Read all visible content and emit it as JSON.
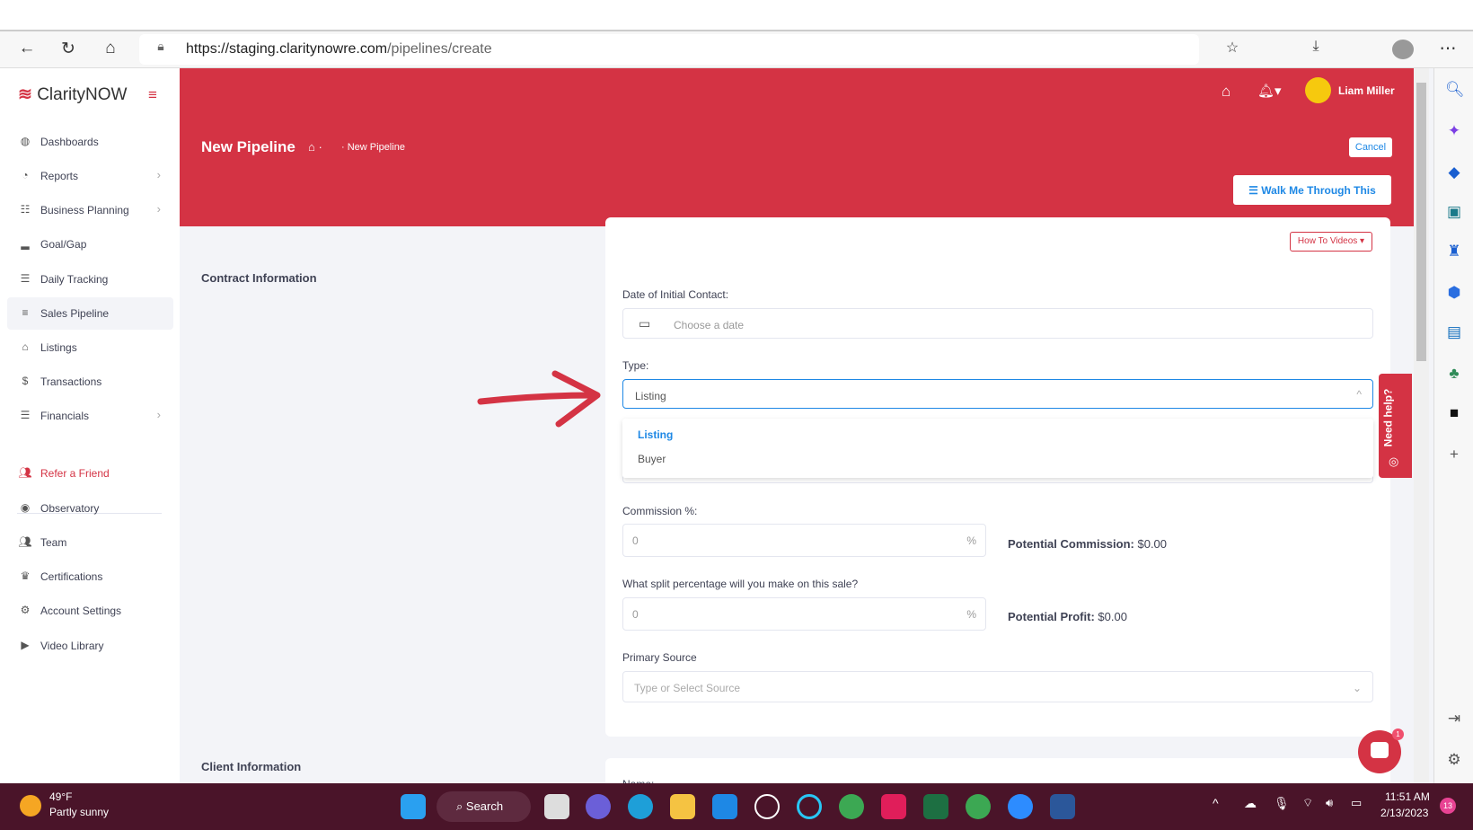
{
  "browser": {
    "url_host": "https://staging.claritynowre.com",
    "url_path": "/pipelines/create"
  },
  "app": {
    "name": "ClarityNOW"
  },
  "sidebar": {
    "items": [
      {
        "label": "Dashboards",
        "icon": "dashboard-icon",
        "chevron": false
      },
      {
        "label": "Reports",
        "icon": "pie-chart-icon",
        "chevron": true
      },
      {
        "label": "Business Planning",
        "icon": "checklist-icon",
        "chevron": true
      },
      {
        "label": "Goal/Gap",
        "icon": "bar-signal-icon",
        "chevron": false
      },
      {
        "label": "Daily Tracking",
        "icon": "list-icon",
        "chevron": false
      },
      {
        "label": "Sales Pipeline",
        "icon": "menu-icon",
        "chevron": false,
        "active": true
      },
      {
        "label": "Listings",
        "icon": "home-icon",
        "chevron": false
      },
      {
        "label": "Transactions",
        "icon": "dollar-icon",
        "chevron": false
      },
      {
        "label": "Financials",
        "icon": "coins-icon",
        "chevron": true
      }
    ],
    "items2": [
      {
        "label": "Refer a Friend",
        "icon": "users-icon"
      },
      {
        "label": "Observatory",
        "icon": "eye-icon"
      },
      {
        "label": "Team",
        "icon": "team-icon"
      },
      {
        "label": "Certifications",
        "icon": "crown-icon"
      },
      {
        "label": "Account Settings",
        "icon": "gear-icon"
      },
      {
        "label": "Video Library",
        "icon": "play-icon"
      }
    ]
  },
  "header": {
    "user": "Liam Miller",
    "title": "New Pipeline",
    "breadcrumb": "New Pipeline",
    "cancel": "Cancel",
    "walk": "Walk Me Through This"
  },
  "form": {
    "section": "Contract Information",
    "how_to": "How To Videos",
    "date_label": "Date of Initial Contact:",
    "date_placeholder": "Choose a date",
    "type_label": "Type:",
    "type_value": "Listing",
    "type_options": [
      "Listing",
      "Buyer"
    ],
    "commission_label": "Commission %:",
    "commission_value": "0",
    "pct": "%",
    "potential_commission_label": "Potential Commission:",
    "potential_commission": "$0.00",
    "split_label": "What split percentage will you make on this sale?",
    "split_value": "0",
    "potential_profit_label": "Potential Profit:",
    "potential_profit": "$0.00",
    "source_label": "Primary Source",
    "source_placeholder": "Type or Select Source",
    "client_section": "Client Information",
    "name_label": "Name:"
  },
  "help": {
    "label": "Need help?",
    "chat_badge": "1"
  },
  "taskbar": {
    "temp": "49°F",
    "weather": "Partly sunny",
    "search": "Search",
    "time": "11:51 AM",
    "date": "2/13/2023",
    "notif": "13"
  },
  "colors": {
    "brand": "#d43344",
    "link": "#1e88e5",
    "taskbar": "#4a1429"
  }
}
